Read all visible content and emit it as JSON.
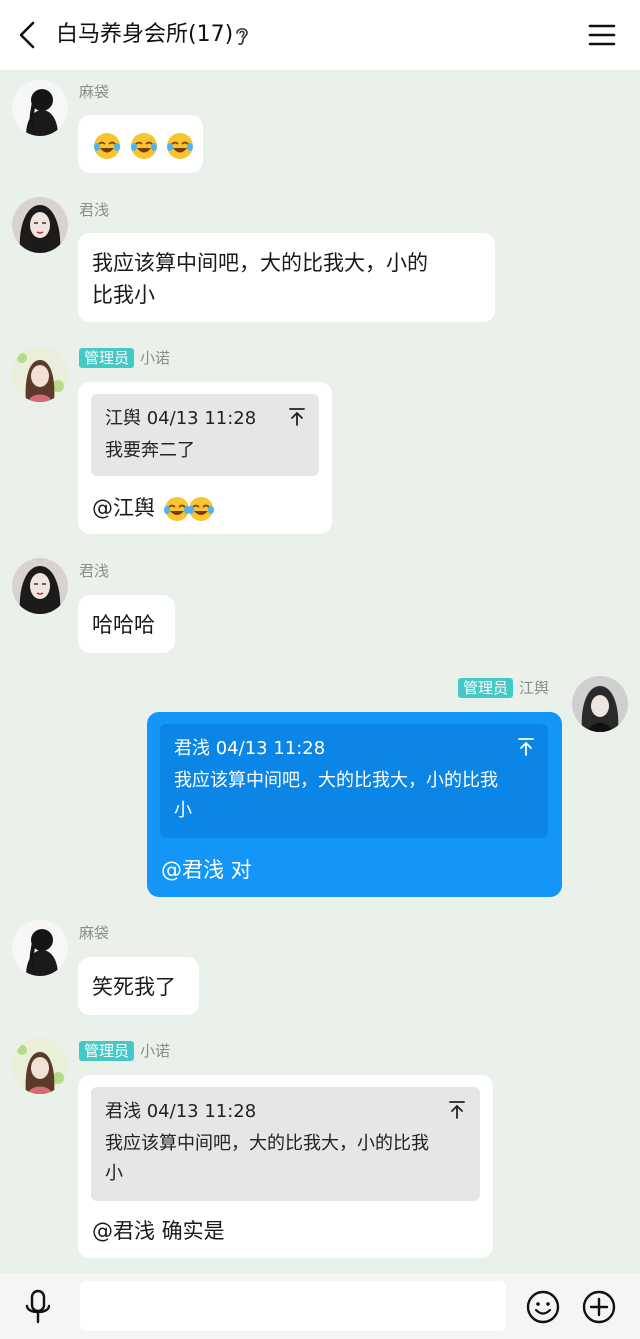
{
  "header": {
    "title": "白马养身会所(17)"
  },
  "messages": [
    {
      "sender": "麻袋",
      "text": "",
      "emoji": [
        "laughing-crying-emoji",
        "laughing-crying-emoji",
        "laughing-crying-emoji"
      ]
    },
    {
      "sender": "君浅",
      "line1": "我应该算中间吧，大的比我大，小的",
      "line2": "比我小"
    },
    {
      "badge": "管理员",
      "sender": "小诺",
      "quote_head": "江舆 04/13 11:28",
      "quote_text": "我要奔二了",
      "text": "@江舆",
      "emoji": [
        "laughing-crying-emoji",
        "laughing-crying-emoji"
      ]
    },
    {
      "sender": "君浅",
      "text": "哈哈哈"
    },
    {
      "badge": "管理员",
      "sender": "江舆",
      "quote_head": "君浅 04/13 11:28",
      "quote_line1": "我应该算中间吧，大的比我大，小的比我",
      "quote_line2": "小",
      "text": "@君浅 对"
    },
    {
      "sender": "麻袋",
      "text": "笑死我了"
    },
    {
      "badge": "管理员",
      "sender": "小诺",
      "quote_head": "君浅 04/13 11:28",
      "quote_line1": "我应该算中间吧，大的比我大，小的比我",
      "quote_line2": "小",
      "text": "@君浅 确实是"
    }
  ],
  "input": {
    "placeholder": ""
  },
  "colors": {
    "accent_blue": "#1496f8",
    "badge_teal": "#45c9c7",
    "background": "#eaf0ea"
  }
}
